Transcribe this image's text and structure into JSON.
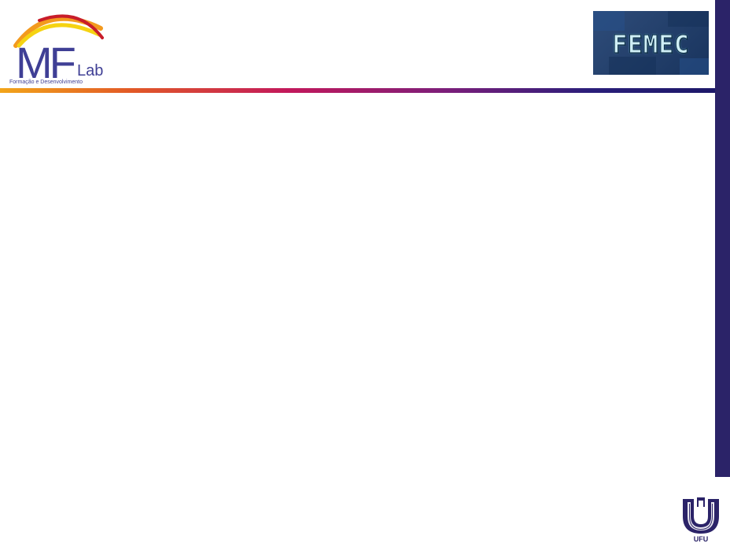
{
  "header": {
    "left_logo": {
      "name": "MF Lab",
      "mark_text": "MF",
      "sub_text": "Lab",
      "tagline": "Formação e Desenvolvimento"
    },
    "right_logo": {
      "text": "FEMEC"
    }
  },
  "footer": {
    "logo_text": "UFU"
  },
  "colors": {
    "background": "#ffffff",
    "side_bar": "#2b2368",
    "rule_start": "#f2a51a",
    "rule_mid": "#c2185b",
    "rule_end": "#1c1868",
    "logo_blue": "#3f3f95"
  },
  "icons": {
    "left_logo": "mflab-logo",
    "right_logo": "femec-logo",
    "footer_logo": "ufu-logo"
  }
}
